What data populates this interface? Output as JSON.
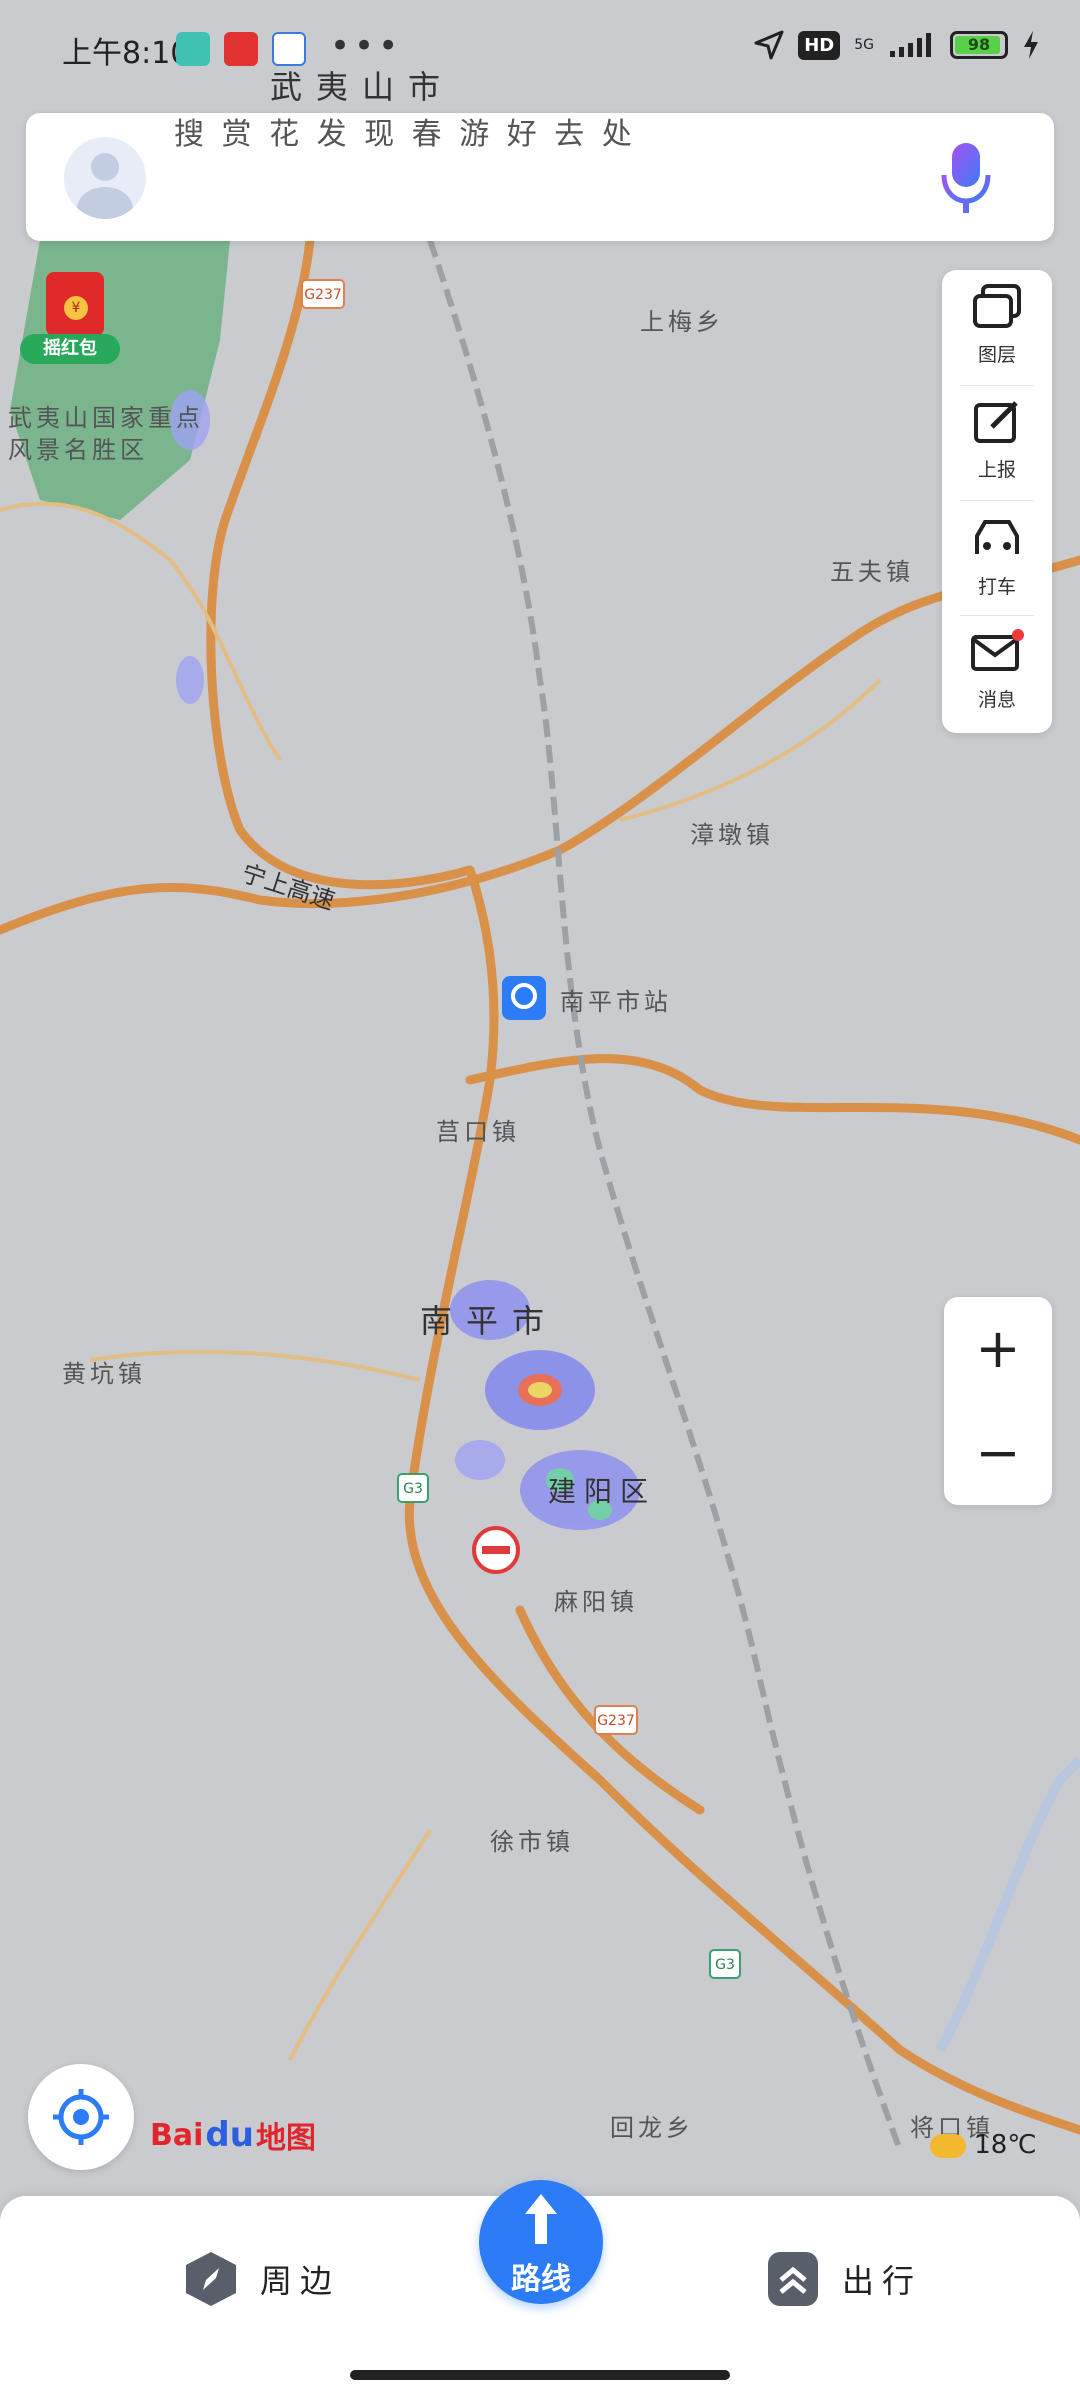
{
  "status_bar": {
    "time": "上午8:10",
    "battery": "98",
    "network": "5G",
    "hd": "HD",
    "more": "•••"
  },
  "search": {
    "placeholder": "搜 赏 花 发 现 春 游 好 去 处"
  },
  "red_packet": {
    "label": "摇红包",
    "coin": "¥"
  },
  "tools": [
    {
      "label": "图层",
      "icon": "layers-icon"
    },
    {
      "label": "上报",
      "icon": "report-edit-icon"
    },
    {
      "label": "打车",
      "icon": "taxi-icon"
    },
    {
      "label": "消息",
      "icon": "mail-icon"
    }
  ],
  "zoom": {
    "in": "+",
    "out": "−"
  },
  "map": {
    "places": [
      {
        "label": "武夷山市"
      },
      {
        "label": "武夷山国家重点风景名胜区"
      },
      {
        "label": "南平市站"
      },
      {
        "label": "南平市"
      },
      {
        "label": "建阳区"
      },
      {
        "label": "上梅乡"
      },
      {
        "label": "五夫镇"
      },
      {
        "label": "莒口镇"
      },
      {
        "label": "麻阳镇"
      },
      {
        "label": "徐市镇"
      },
      {
        "label": "将口镇"
      },
      {
        "label": "回龙乡"
      },
      {
        "label": "漳墩镇"
      },
      {
        "label": "黄坑镇"
      }
    ],
    "roads": [
      {
        "label": "G237"
      },
      {
        "label": "G3"
      },
      {
        "label": "G237"
      },
      {
        "label": "G3"
      },
      {
        "label": "宁上高速"
      }
    ]
  },
  "logo": {
    "bai": "Bai",
    "du": "du",
    "map": "地图"
  },
  "weather": {
    "temp": "18℃"
  },
  "bottom_nav": {
    "nearby": "周边",
    "route": "路线",
    "travel": "出行"
  },
  "colors": {
    "accent": "#2b7cf6",
    "road": "#d9914a",
    "map_bg": "#c9cbcf",
    "scenic": "#5fae78"
  }
}
